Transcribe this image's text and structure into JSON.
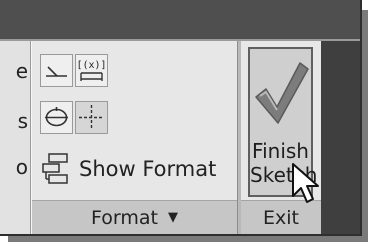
{
  "previous_panel": {
    "partial_letters": [
      "e",
      "s",
      "o"
    ]
  },
  "format_panel": {
    "show_format_label": "Show Format",
    "title": "Format",
    "title_caret": "▼"
  },
  "exit_panel": {
    "finish_line1": "Finish",
    "finish_line2": "Sketch",
    "title": "Exit"
  },
  "colors": {
    "titlebar": "#4f4f4f",
    "panel_bg": "#e7e7e7",
    "panel_title_bg": "#c6c6c6",
    "checkmark": "#7c7c7c"
  },
  "icons": [
    "constraint-icon",
    "dimension-icon",
    "project-geometry-icon",
    "construction-icon",
    "show-format-icon",
    "checkmark-icon",
    "pointer-cursor-icon"
  ]
}
